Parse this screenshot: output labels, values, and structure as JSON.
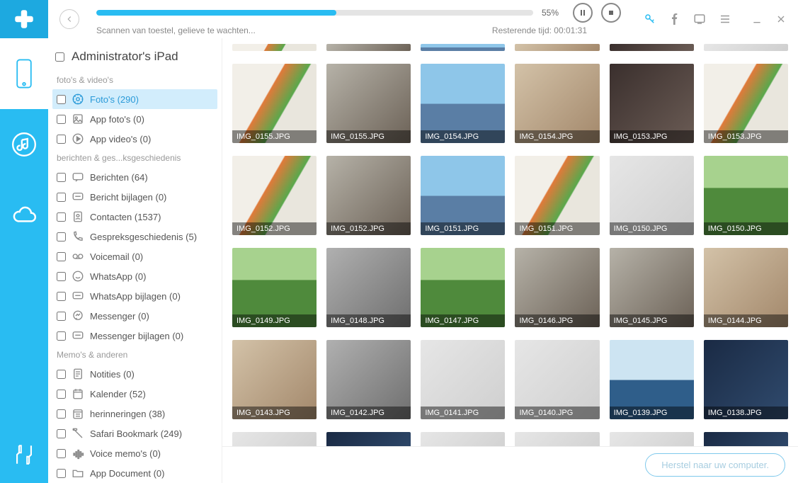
{
  "device_name": "Administrator's iPad",
  "progress": {
    "percent": 55,
    "percent_label": "55%",
    "status_text": "Scannen van toestel, gelieve te wachten...",
    "remaining_label": "Resterende tijd: 00:01:31"
  },
  "footer": {
    "restore_label": "Herstel naar uw computer."
  },
  "sections": [
    {
      "label": "foto's & video's",
      "items": [
        {
          "id": "photos",
          "label": "Foto's (290)",
          "icon": "photos-icon",
          "selected": true
        },
        {
          "id": "app-photos",
          "label": "App foto's (0)",
          "icon": "app-photos-icon",
          "selected": false
        },
        {
          "id": "app-videos",
          "label": "App video's (0)",
          "icon": "app-videos-icon",
          "selected": false
        }
      ]
    },
    {
      "label": "berichten & ges...ksgeschiedenis",
      "items": [
        {
          "id": "messages",
          "label": "Berichten (64)",
          "icon": "messages-icon",
          "selected": false
        },
        {
          "id": "msg-attach",
          "label": "Bericht bijlagen (0)",
          "icon": "attach-icon",
          "selected": false
        },
        {
          "id": "contacts",
          "label": "Contacten (1537)",
          "icon": "contacts-icon",
          "selected": false
        },
        {
          "id": "call-history",
          "label": "Gespreksgeschiedenis (5)",
          "icon": "calls-icon",
          "selected": false
        },
        {
          "id": "voicemail",
          "label": "Voicemail (0)",
          "icon": "voicemail-icon",
          "selected": false
        },
        {
          "id": "whatsapp",
          "label": "WhatsApp (0)",
          "icon": "whatsapp-icon",
          "selected": false
        },
        {
          "id": "whatsapp-attach",
          "label": "WhatsApp bijlagen (0)",
          "icon": "attach-icon",
          "selected": false
        },
        {
          "id": "messenger",
          "label": "Messenger (0)",
          "icon": "messenger-icon",
          "selected": false
        },
        {
          "id": "messenger-attach",
          "label": "Messenger bijlagen (0)",
          "icon": "attach-icon",
          "selected": false
        }
      ]
    },
    {
      "label": "Memo's & anderen",
      "items": [
        {
          "id": "notes",
          "label": "Notities (0)",
          "icon": "notes-icon",
          "selected": false
        },
        {
          "id": "calendar",
          "label": "Kalender (52)",
          "icon": "calendar-icon",
          "selected": false
        },
        {
          "id": "reminders",
          "label": "herinneringen (38)",
          "icon": "reminders-icon",
          "selected": false
        },
        {
          "id": "safari-bm",
          "label": "Safari Bookmark (249)",
          "icon": "bookmark-icon",
          "selected": false
        },
        {
          "id": "voice-memos",
          "label": "Voice memo's (0)",
          "icon": "voicememo-icon",
          "selected": false
        },
        {
          "id": "app-doc",
          "label": "App Document (0)",
          "icon": "folder-icon",
          "selected": false
        }
      ]
    }
  ],
  "photos": [
    {
      "name": "IMG_0155.JPG",
      "ph": "ph1"
    },
    {
      "name": "IMG_0155.JPG",
      "ph": "ph2"
    },
    {
      "name": "IMG_0154.JPG",
      "ph": "ph3"
    },
    {
      "name": "IMG_0154.JPG",
      "ph": "ph4"
    },
    {
      "name": "IMG_0153.JPG",
      "ph": "ph5"
    },
    {
      "name": "IMG_0153.JPG",
      "ph": "ph1"
    },
    {
      "name": "IMG_0152.JPG",
      "ph": "ph1"
    },
    {
      "name": "IMG_0152.JPG",
      "ph": "ph2"
    },
    {
      "name": "IMG_0151.JPG",
      "ph": "ph3"
    },
    {
      "name": "IMG_0151.JPG",
      "ph": "ph1"
    },
    {
      "name": "IMG_0150.JPG",
      "ph": "ph6"
    },
    {
      "name": "IMG_0150.JPG",
      "ph": "ph7"
    },
    {
      "name": "IMG_0149.JPG",
      "ph": "ph7"
    },
    {
      "name": "IMG_0148.JPG",
      "ph": "ph8"
    },
    {
      "name": "IMG_0147.JPG",
      "ph": "ph7"
    },
    {
      "name": "IMG_0146.JPG",
      "ph": "ph2"
    },
    {
      "name": "IMG_0145.JPG",
      "ph": "ph2"
    },
    {
      "name": "IMG_0144.JPG",
      "ph": "ph4"
    },
    {
      "name": "IMG_0143.JPG",
      "ph": "ph4"
    },
    {
      "name": "IMG_0142.JPG",
      "ph": "ph8"
    },
    {
      "name": "IMG_0141.JPG",
      "ph": "ph6"
    },
    {
      "name": "IMG_0140.JPG",
      "ph": "ph6"
    },
    {
      "name": "IMG_0139.JPG",
      "ph": "ph10"
    },
    {
      "name": "IMG_0138.JPG",
      "ph": "ph9"
    }
  ],
  "colors": {
    "accent": "#29bcf2"
  }
}
